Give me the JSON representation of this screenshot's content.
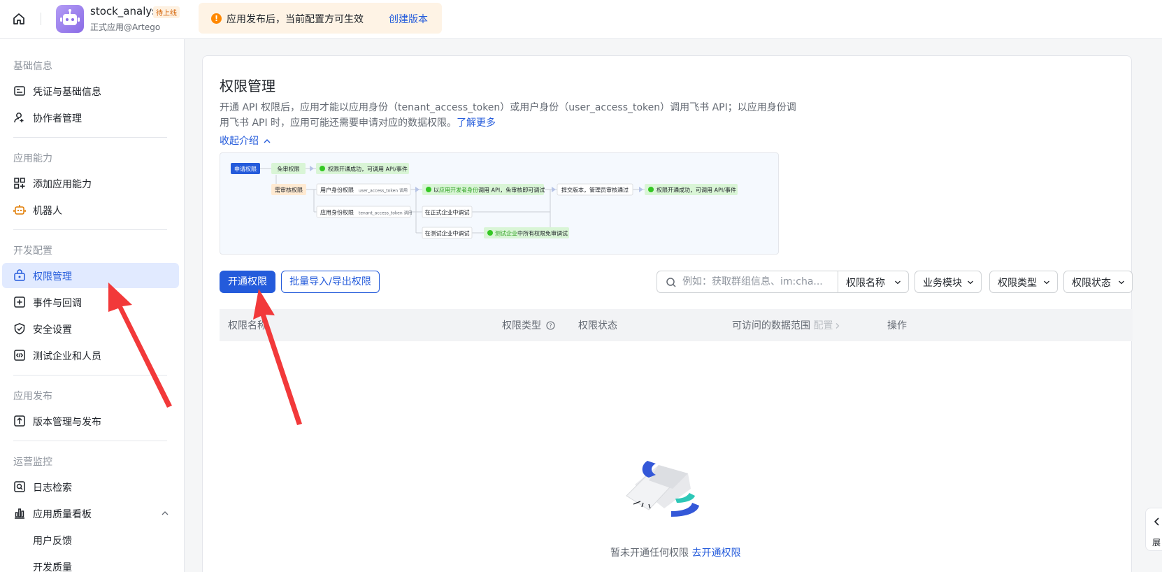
{
  "topbar": {
    "app_name": "stock_analyst",
    "app_badge": "待上线",
    "app_subtitle": "正式应用@Artego",
    "notice_text": "应用发布后，当前配置方可生效",
    "notice_link": "创建版本"
  },
  "sidebar": {
    "sections": [
      {
        "title": "基础信息",
        "items": [
          {
            "label": "凭证与基础信息",
            "icon": "id-card-icon"
          },
          {
            "label": "协作者管理",
            "icon": "user-add-icon"
          }
        ]
      },
      {
        "title": "应用能力",
        "items": [
          {
            "label": "添加应用能力",
            "icon": "grid-add-icon"
          },
          {
            "label": "机器人",
            "icon": "robot-icon"
          }
        ]
      },
      {
        "title": "开发配置",
        "items": [
          {
            "label": "权限管理",
            "icon": "lock-box-icon",
            "active": true
          },
          {
            "label": "事件与回调",
            "icon": "plus-box-icon"
          },
          {
            "label": "安全设置",
            "icon": "shield-icon"
          },
          {
            "label": "测试企业和人员",
            "icon": "code-box-icon"
          }
        ]
      },
      {
        "title": "应用发布",
        "items": [
          {
            "label": "版本管理与发布",
            "icon": "upload-box-icon"
          }
        ]
      },
      {
        "title": "运营监控",
        "items": [
          {
            "label": "日志检索",
            "icon": "log-search-icon"
          },
          {
            "label": "应用质量看板",
            "icon": "bar-chart-icon"
          },
          {
            "label": "用户反馈"
          },
          {
            "label": "开发质量"
          }
        ]
      }
    ]
  },
  "main": {
    "title": "权限管理",
    "desc_line1": "开通 API 权限后，应用才能以应用身份（tenant_access_token）或用户身份（user_access_token）调用飞书 API；以应用身份调",
    "desc_line2": "用飞书 API 时，应用可能还需要申请对应的数据权限。",
    "desc_link": "了解更多",
    "collapse_label": "收起介绍",
    "flow": {
      "apply": "申请权限",
      "free": "免审权限",
      "free_result": "权限开通成功，可调用 API/事件",
      "review": "需审核权限",
      "user_identity": "用户身份权限",
      "user_token": "user_access_token 调用",
      "dev_identity_prefix": "以",
      "dev_identity_highlight": "应用开发者身份",
      "dev_identity_suffix": "调用 API，免审核即可调试",
      "submit": "提交版本，管理员审核通过",
      "final_result": "权限开通成功，可调用 API/事件",
      "app_identity": "应用身份权限",
      "tenant_token": "tenant_access_token 调用",
      "prod_debug": "在正式企业中调试",
      "test_debug": "在测试企业中调试",
      "test_enterprise_highlight": "测试企业",
      "test_enterprise_suffix": "中所有权限免审调试"
    },
    "btn_open": "开通权限",
    "btn_batch": "批量导入/导出权限",
    "search_placeholder": "例如：获取群组信息、im:cha...",
    "filters": {
      "name": "权限名称",
      "module": "业务模块",
      "type": "权限类型",
      "status": "权限状态"
    },
    "columns": {
      "name": "权限名称",
      "type": "权限类型",
      "status": "权限状态",
      "scope": "可访问的数据范围",
      "scope_config": "配置",
      "action": "操作"
    },
    "empty_text": "暂未开通任何权限",
    "empty_link": "去开通权限"
  },
  "side_tab": {
    "label": "展"
  },
  "colors": {
    "primary": "#245bdb",
    "active_bg": "#e1eaff",
    "arrow": "#f2393a"
  }
}
